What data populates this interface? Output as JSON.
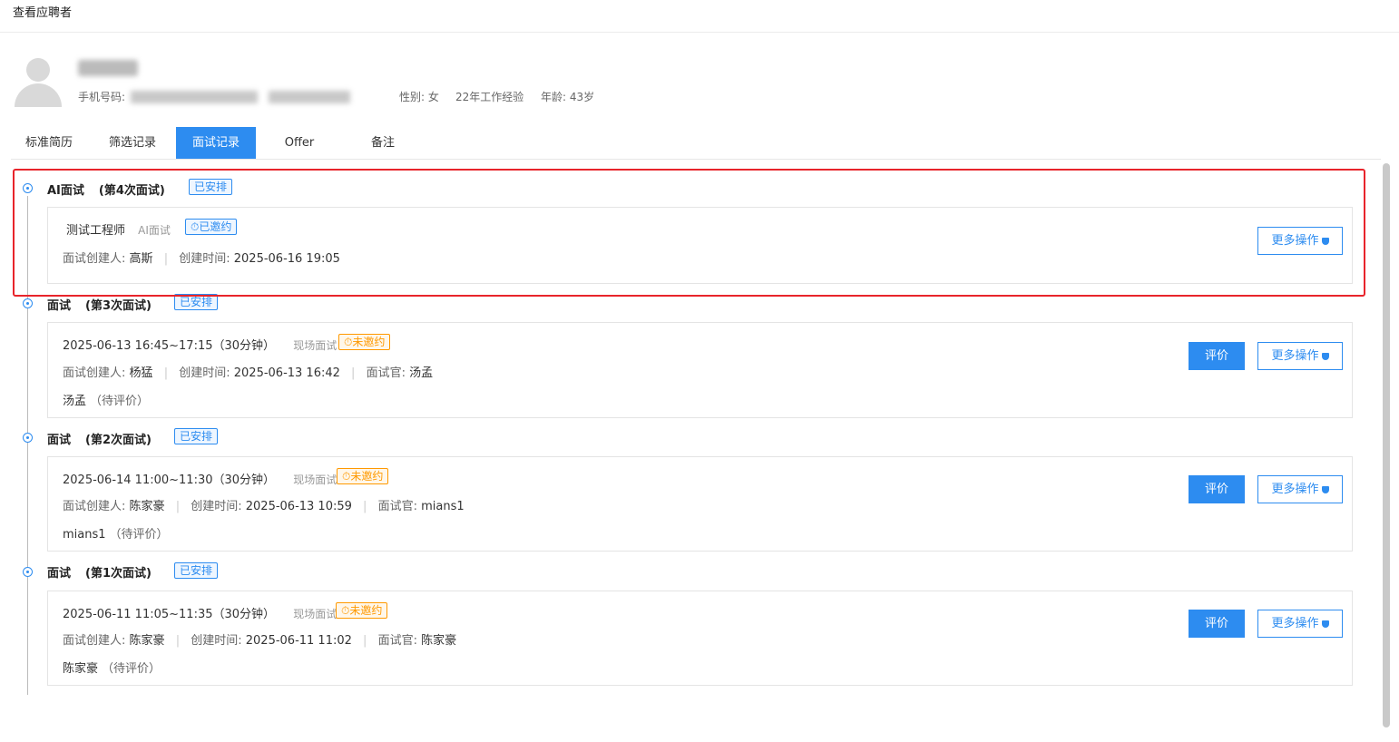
{
  "header": {
    "title": "查看应聘者"
  },
  "applicant": {
    "name": "",
    "phone_label": "手机号码:",
    "phone_value": "188···2500",
    "email_value": "···@qq.com",
    "gender": "性别: 女",
    "experience": "22年工作经验",
    "age": "年龄: 43岁"
  },
  "tabs": [
    {
      "label": "标准简历",
      "active": false
    },
    {
      "label": "筛选记录",
      "active": false
    },
    {
      "label": "面试记录",
      "active": true
    },
    {
      "label": "Offer",
      "active": false
    },
    {
      "label": "备注",
      "active": false
    }
  ],
  "rounds": [
    {
      "title": "AI面试",
      "round": "(第4次面试)",
      "status": "已安排",
      "card": {
        "line1_main": "测试工程师",
        "line1_type": "AI面试",
        "invite": "已邀约",
        "invite_color": "blue",
        "creator_label": "面试创建人:",
        "creator": "高斯",
        "created_label": "创建时间:",
        "created": "2025-06-16 19:05"
      },
      "more_label": "更多操作"
    },
    {
      "title": "面试",
      "round": "(第3次面试)",
      "status": "已安排",
      "card": {
        "line1_main": "2025-06-13 16:45~17:15（30分钟）",
        "line1_type": "现场面试",
        "invite": "未邀约",
        "invite_color": "orange",
        "creator_label": "面试创建人:",
        "creator": "杨猛",
        "created_label": "创建时间:",
        "created": "2025-06-13 16:42",
        "interviewer_label": "面试官:",
        "interviewer": "汤孟",
        "eval_name": "汤孟",
        "eval_status": "（待评价）"
      },
      "eval_label": "评价",
      "more_label": "更多操作"
    },
    {
      "title": "面试",
      "round": "(第2次面试)",
      "status": "已安排",
      "card": {
        "line1_main": "2025-06-14 11:00~11:30（30分钟）",
        "line1_type": "现场面试",
        "invite": "未邀约",
        "invite_color": "orange",
        "creator_label": "面试创建人:",
        "creator": "陈家豪",
        "created_label": "创建时间:",
        "created": "2025-06-13 10:59",
        "interviewer_label": "面试官:",
        "interviewer": "mians1",
        "eval_name": "mians1",
        "eval_status": "（待评价）"
      },
      "eval_label": "评价",
      "more_label": "更多操作"
    },
    {
      "title": "面试",
      "round": "(第1次面试)",
      "status": "已安排",
      "card": {
        "line1_main": "2025-06-11 11:05~11:35（30分钟）",
        "line1_type": "现场面试",
        "invite": "未邀约",
        "invite_color": "orange",
        "creator_label": "面试创建人:",
        "creator": "陈家豪",
        "created_label": "创建时间:",
        "created": "2025-06-11 11:02",
        "interviewer_label": "面试官:",
        "interviewer": "陈家豪",
        "eval_name": "陈家豪",
        "eval_status": "（待评价）"
      },
      "eval_label": "评价",
      "more_label": "更多操作"
    }
  ],
  "colors": {
    "accent": "#2d8cf0",
    "warning": "#ff9900",
    "highlight": "#e8242b"
  }
}
